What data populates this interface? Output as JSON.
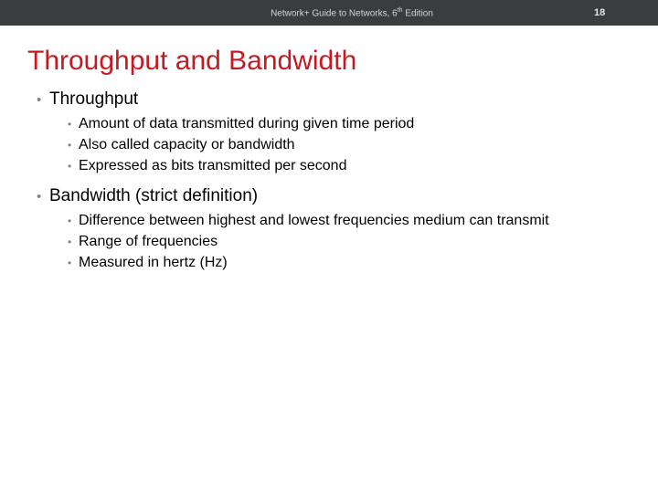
{
  "header": {
    "title_prefix": "Network+ Guide to Networks, 6",
    "title_ordinal": "th",
    "title_suffix": " Edition",
    "page_number": "18"
  },
  "slide": {
    "title": "Throughput and Bandwidth",
    "bullets_level1": [
      {
        "label": "Throughput",
        "sub": [
          "Amount of data transmitted during given time period",
          "Also called capacity or bandwidth",
          "Expressed as bits transmitted per second"
        ]
      },
      {
        "label": "Bandwidth (strict definition)",
        "sub": [
          "Difference between highest and lowest frequencies medium can transmit",
          "Range of frequencies",
          "Measured in hertz (Hz)"
        ]
      }
    ]
  },
  "glyphs": {
    "bullet_l1": "•",
    "bullet_l2": "•"
  }
}
